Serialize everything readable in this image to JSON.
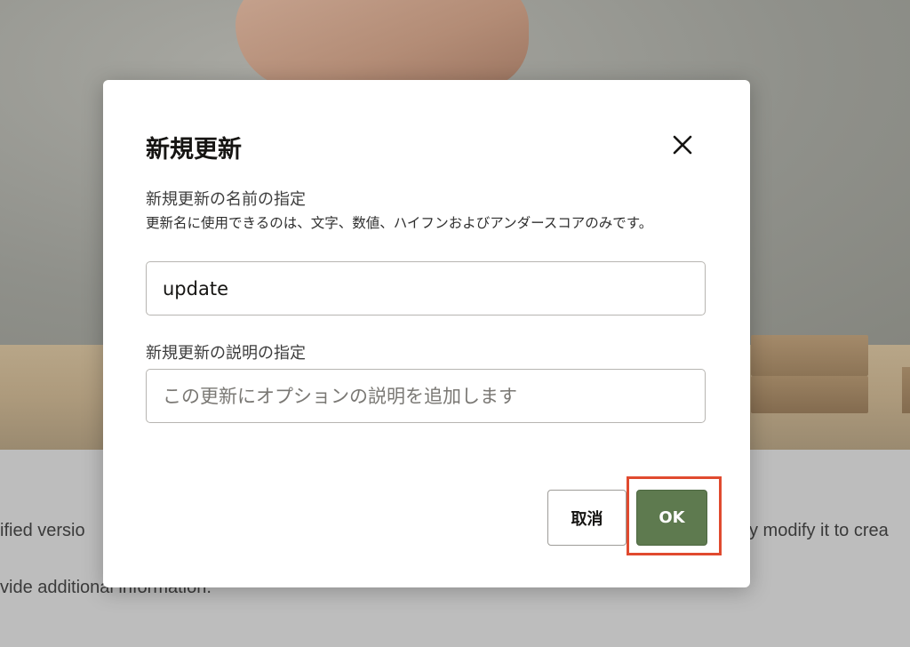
{
  "background": {
    "text_line1_left": "ified versio",
    "text_line1_right": "y modify it to crea",
    "text_line2": "vide additional information."
  },
  "dialog": {
    "title": "新規更新",
    "close_label": "close",
    "name_label": "新規更新の名前の指定",
    "name_hint": "更新名に使用できるのは、文字、数値、ハイフンおよびアンダースコアのみです。",
    "name_value": "update",
    "description_label": "新規更新の説明の指定",
    "description_placeholder": "この更新にオプションの説明を追加します",
    "description_value": "",
    "cancel_label": "取消",
    "ok_label": "OK"
  },
  "colors": {
    "ok_button": "#5e7a4f",
    "highlight": "#e04a2f"
  },
  "icons": {
    "close": "close-icon"
  }
}
